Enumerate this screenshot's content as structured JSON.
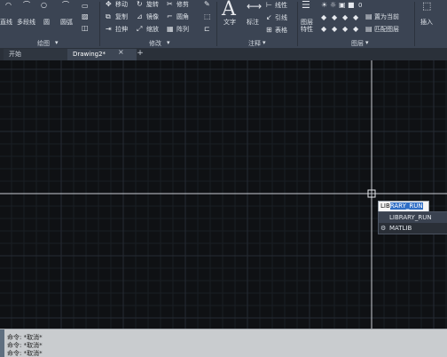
{
  "ribbon": {
    "draw_tools": {
      "line": "直线",
      "polyline": "多段线",
      "circle": "圆",
      "arc": "圆弧"
    },
    "modify_tools": {
      "move": "移动",
      "rotate": "旋转",
      "trim": "修剪",
      "copy": "复制",
      "mirror": "镜像",
      "fillet": "圆角",
      "stretch": "拉伸",
      "scale": "缩放",
      "array": "阵列"
    },
    "annotation_tools": {
      "text": "文字",
      "dimension": "标注",
      "linear": "线性",
      "leader": "引线",
      "table": "表格"
    },
    "layer_tools": {
      "layer_properties": "图层特性",
      "layer_value": "0",
      "set_current": "置为当前",
      "match_layer": "匹配图层"
    },
    "insert": "插入",
    "panels": {
      "draw": "绘图",
      "modify": "修改",
      "annotation": "注释",
      "layers": "图层"
    }
  },
  "tabs": {
    "start": "开始",
    "drawing": "Drawing2*",
    "close": "×",
    "add": "+"
  },
  "command_popup": {
    "typed_plain": "LIB",
    "typed_selected": "RARY_RUN",
    "suggestions": [
      {
        "label": "LIBRARY_RUN",
        "icon": "none"
      },
      {
        "label": "MATLIB",
        "icon": "material-library-icon"
      }
    ]
  },
  "command_line": {
    "gutter_label": "稍",
    "history": [
      "命令: *取消*",
      "命令: *取消*",
      "命令: *取消*"
    ]
  },
  "colors": {
    "ribbon_bg": "#3b4453",
    "canvas_bg": "#0f1114",
    "highlight": "#2f6ec5",
    "command_bg": "#c9cccf"
  }
}
